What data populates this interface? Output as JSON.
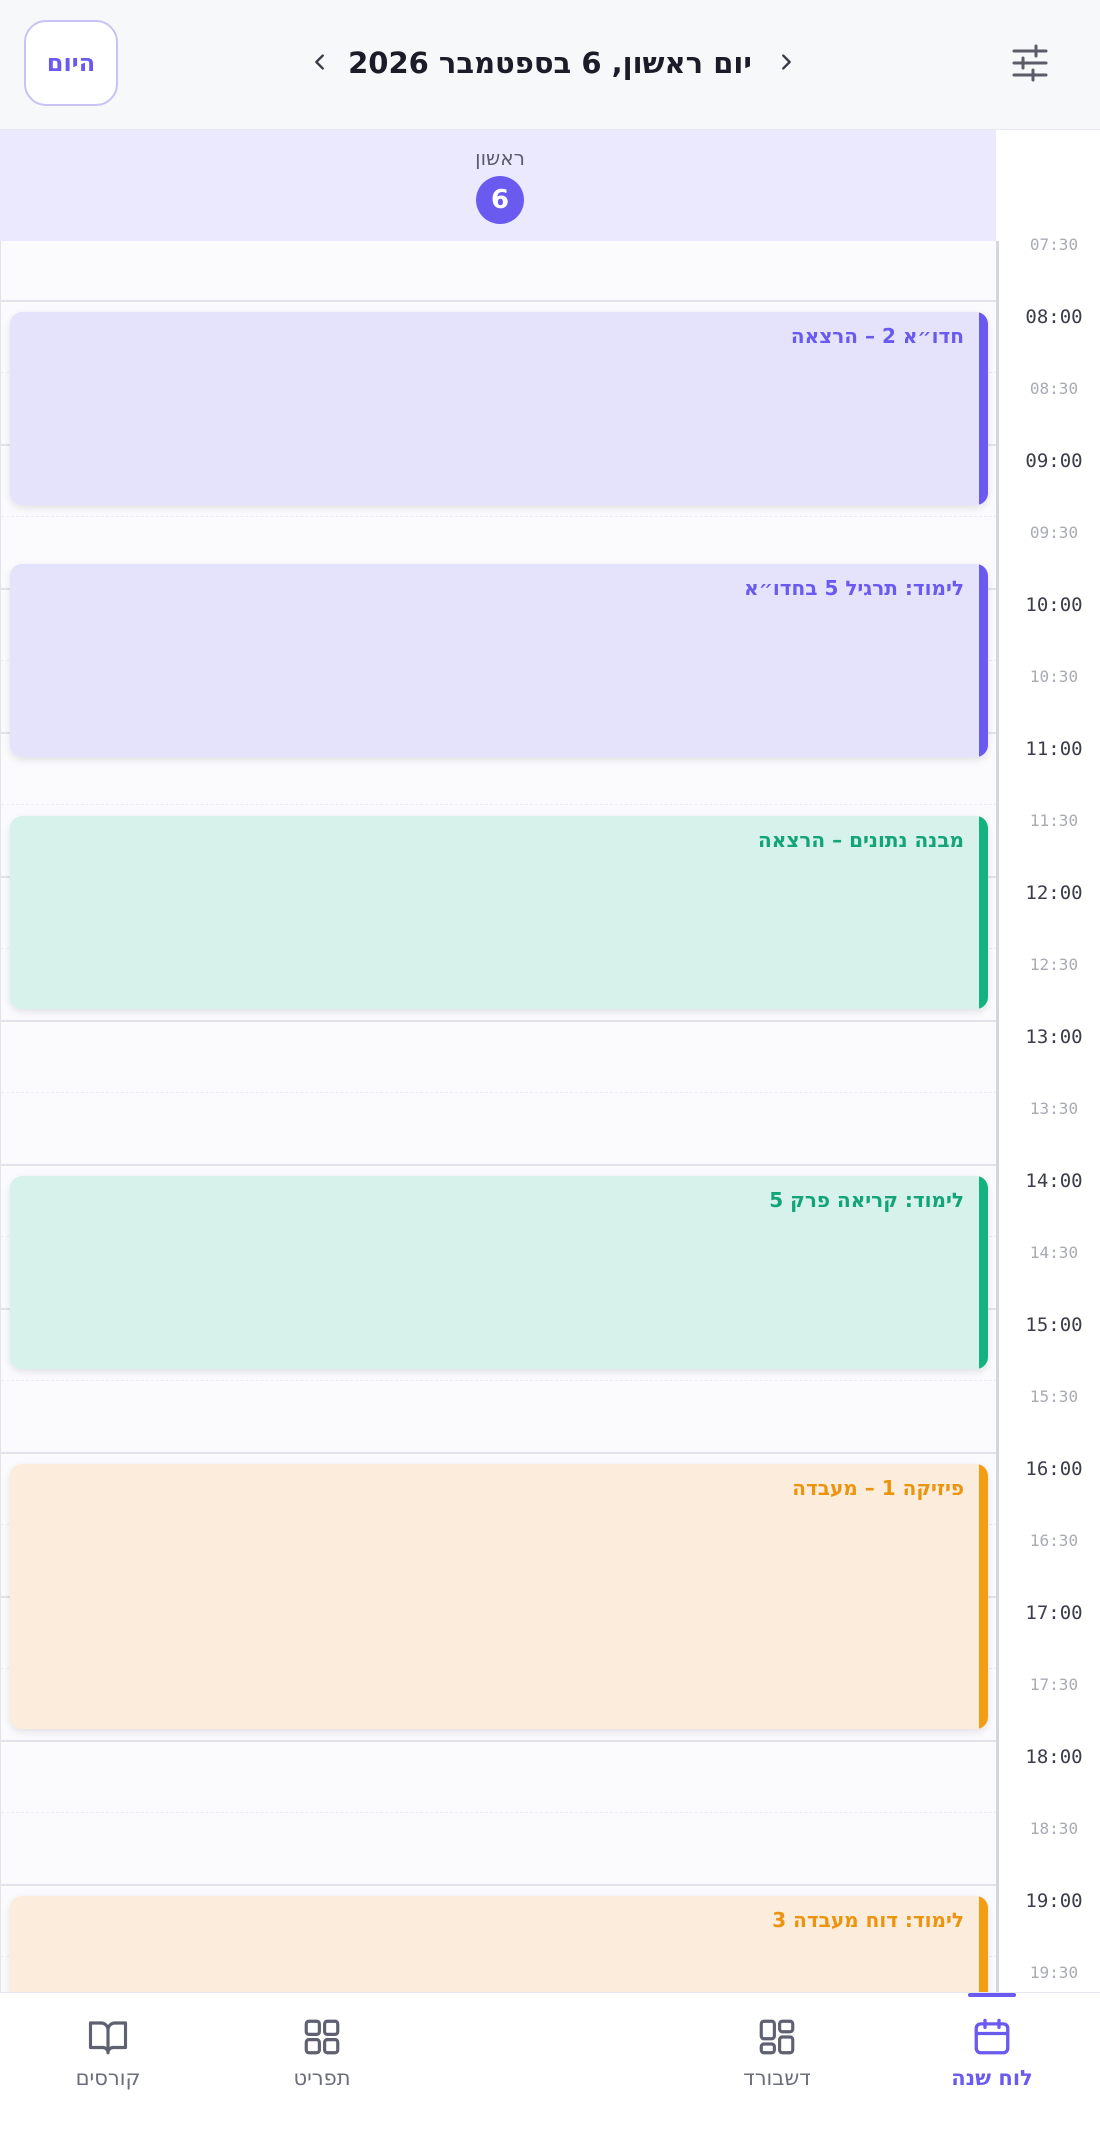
{
  "header": {
    "today_label": "היום",
    "date_title": "יום ראשון, 6 בספטמבר 2026"
  },
  "day_header": {
    "day_name": "ראשון",
    "day_number": "6"
  },
  "time_labels": {
    "t0730": "07:30",
    "t0800": "08:00",
    "t0830": "08:30",
    "t0900": "09:00",
    "t0930": "09:30",
    "t1000": "10:00",
    "t1030": "10:30",
    "t1100": "11:00",
    "t1130": "11:30",
    "t1200": "12:00",
    "t1230": "12:30",
    "t1300": "13:00",
    "t1330": "13:30",
    "t1400": "14:00",
    "t1430": "14:30",
    "t1500": "15:00",
    "t1530": "15:30",
    "t1600": "16:00",
    "t1630": "16:30",
    "t1700": "17:00",
    "t1730": "17:30",
    "t1800": "18:00",
    "t1830": "18:30",
    "t1900": "19:00",
    "t1930": "19:30"
  },
  "events": [
    {
      "title": "חדו״א 2 – הרצאה",
      "color": "#6a5af0"
    },
    {
      "title": "לימוד: תרגיל 5 בחדו״א",
      "color": "#6a5af0"
    },
    {
      "title": "מבנה נתונים – הרצאה",
      "color": "#14b27f"
    },
    {
      "title": "לימוד: קריאה פרק 5",
      "color": "#14b27f"
    },
    {
      "title": "פיזיקה 1 – מעבדה",
      "color": "#f29d14"
    },
    {
      "title": "לימוד: דוח מעבדה 3",
      "color": "#f29d14"
    }
  ],
  "nav": {
    "courses": "קורסים",
    "menu": "תפריט",
    "dashboard": "דשבורד",
    "calendar": "לוח שנה"
  },
  "colors": {
    "accent": "#6a5af0",
    "green": "#14b27f",
    "orange": "#f29d14"
  }
}
